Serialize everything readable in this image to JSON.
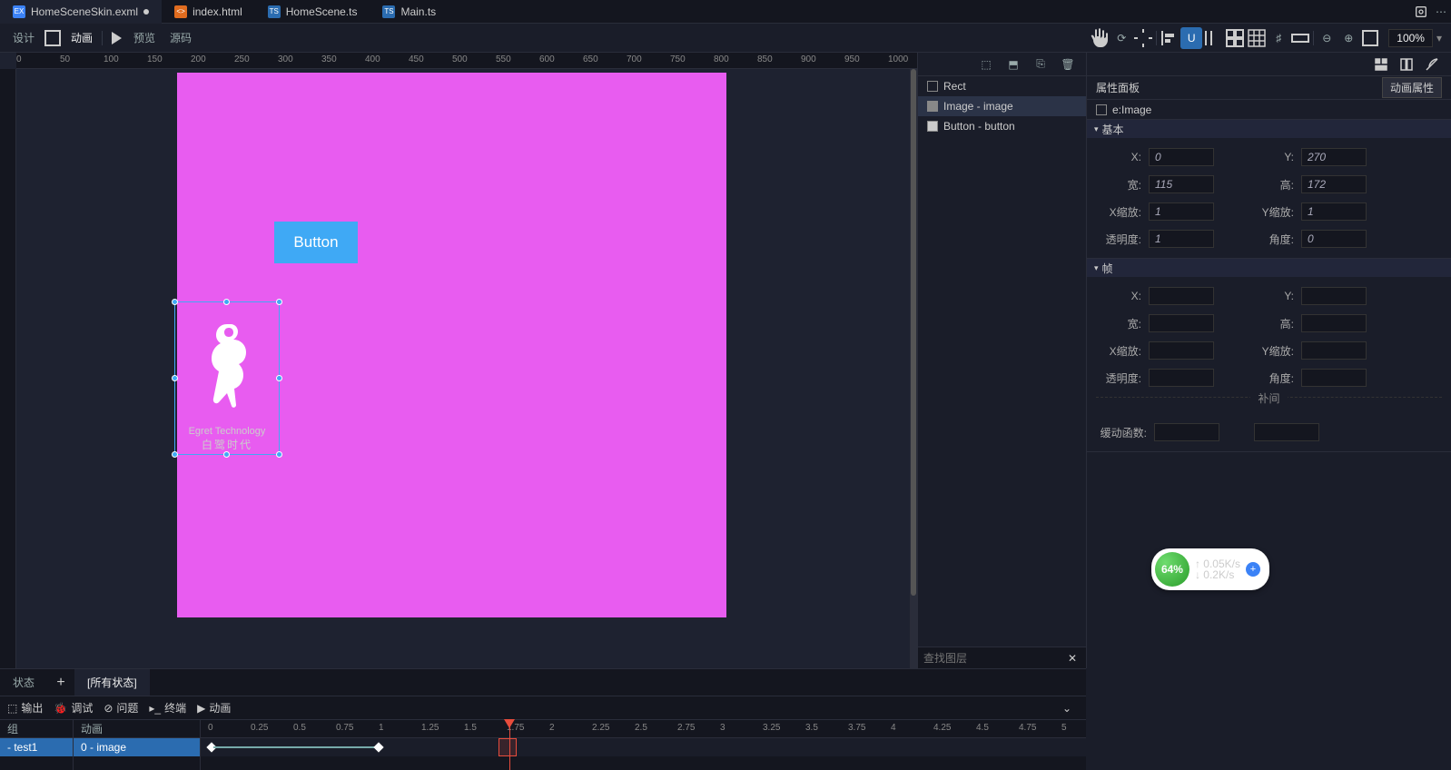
{
  "tabs": [
    {
      "label": "HomeSceneSkin.exml",
      "icon": "EX",
      "modified": true,
      "active": true
    },
    {
      "label": "index.html",
      "icon": "<>",
      "modified": false,
      "active": false
    },
    {
      "label": "HomeScene.ts",
      "icon": "TS",
      "modified": false,
      "active": false
    },
    {
      "label": "Main.ts",
      "icon": "TS",
      "modified": false,
      "active": false
    }
  ],
  "subbar": {
    "design": "设计",
    "anim": "动画",
    "preview": "预览",
    "source": "源码",
    "zoom": "100%"
  },
  "canvas": {
    "button_label": "Button",
    "logo_line1": "Egret Technology",
    "logo_line2": "白鹭时代",
    "ruler_ticks": [
      "0",
      "50",
      "100",
      "150",
      "200",
      "250",
      "300",
      "350",
      "400",
      "450",
      "500",
      "550",
      "600",
      "650",
      "700",
      "750",
      "800",
      "850",
      "900",
      "950",
      "1000"
    ]
  },
  "layers": {
    "items": [
      {
        "label": "Rect",
        "selected": false
      },
      {
        "label": "Image - image",
        "selected": true
      },
      {
        "label": "Button - button",
        "selected": false
      }
    ],
    "search_placeholder": "查找图层"
  },
  "props": {
    "panel_title": "属性面板",
    "anim_attr_btn": "动画属性",
    "type_label": "e:Image",
    "sec_basic": "基本",
    "sec_frame": "帧",
    "tween_label": "补间",
    "ease_label": "缓动函数:",
    "fields_basic": {
      "x_label": "X:",
      "x_val": "0",
      "y_label": "Y:",
      "y_val": "270",
      "w_label": "宽:",
      "w_val": "115",
      "h_label": "高:",
      "h_val": "172",
      "sx_label": "X缩放:",
      "sx_val": "1",
      "sy_label": "Y缩放:",
      "sy_val": "1",
      "op_label": "透明度:",
      "op_val": "1",
      "ang_label": "角度:",
      "ang_val": "0"
    },
    "fields_frame": {
      "x_label": "X:",
      "y_label": "Y:",
      "w_label": "宽:",
      "h_label": "高:",
      "sx_label": "X缩放:",
      "sy_label": "Y缩放:",
      "op_label": "透明度:",
      "ang_label": "角度:"
    }
  },
  "statebar": {
    "state": "状态",
    "all_states": "[所有状态]"
  },
  "bottbar": {
    "output": "输出",
    "debug": "调试",
    "problem": "问题",
    "terminal": "终端",
    "anim": "动画"
  },
  "timeline": {
    "group_head": "组",
    "anim_head": "动画",
    "group_item": "- test1",
    "anim_item": "0 - image",
    "ticks": [
      "0",
      "0.25",
      "0.5",
      "0.75",
      "1",
      "1.25",
      "1.5",
      "1.75",
      "2",
      "2.25",
      "2.5",
      "2.75",
      "3",
      "3.25",
      "3.5",
      "3.75",
      "4",
      "4.25",
      "4.5",
      "4.75",
      "5"
    ],
    "playhead_at": 1.75
  },
  "netwidget": {
    "pct": "64%",
    "up": "↑ 0.05K/s",
    "down": "↓ 0.2K/s"
  }
}
